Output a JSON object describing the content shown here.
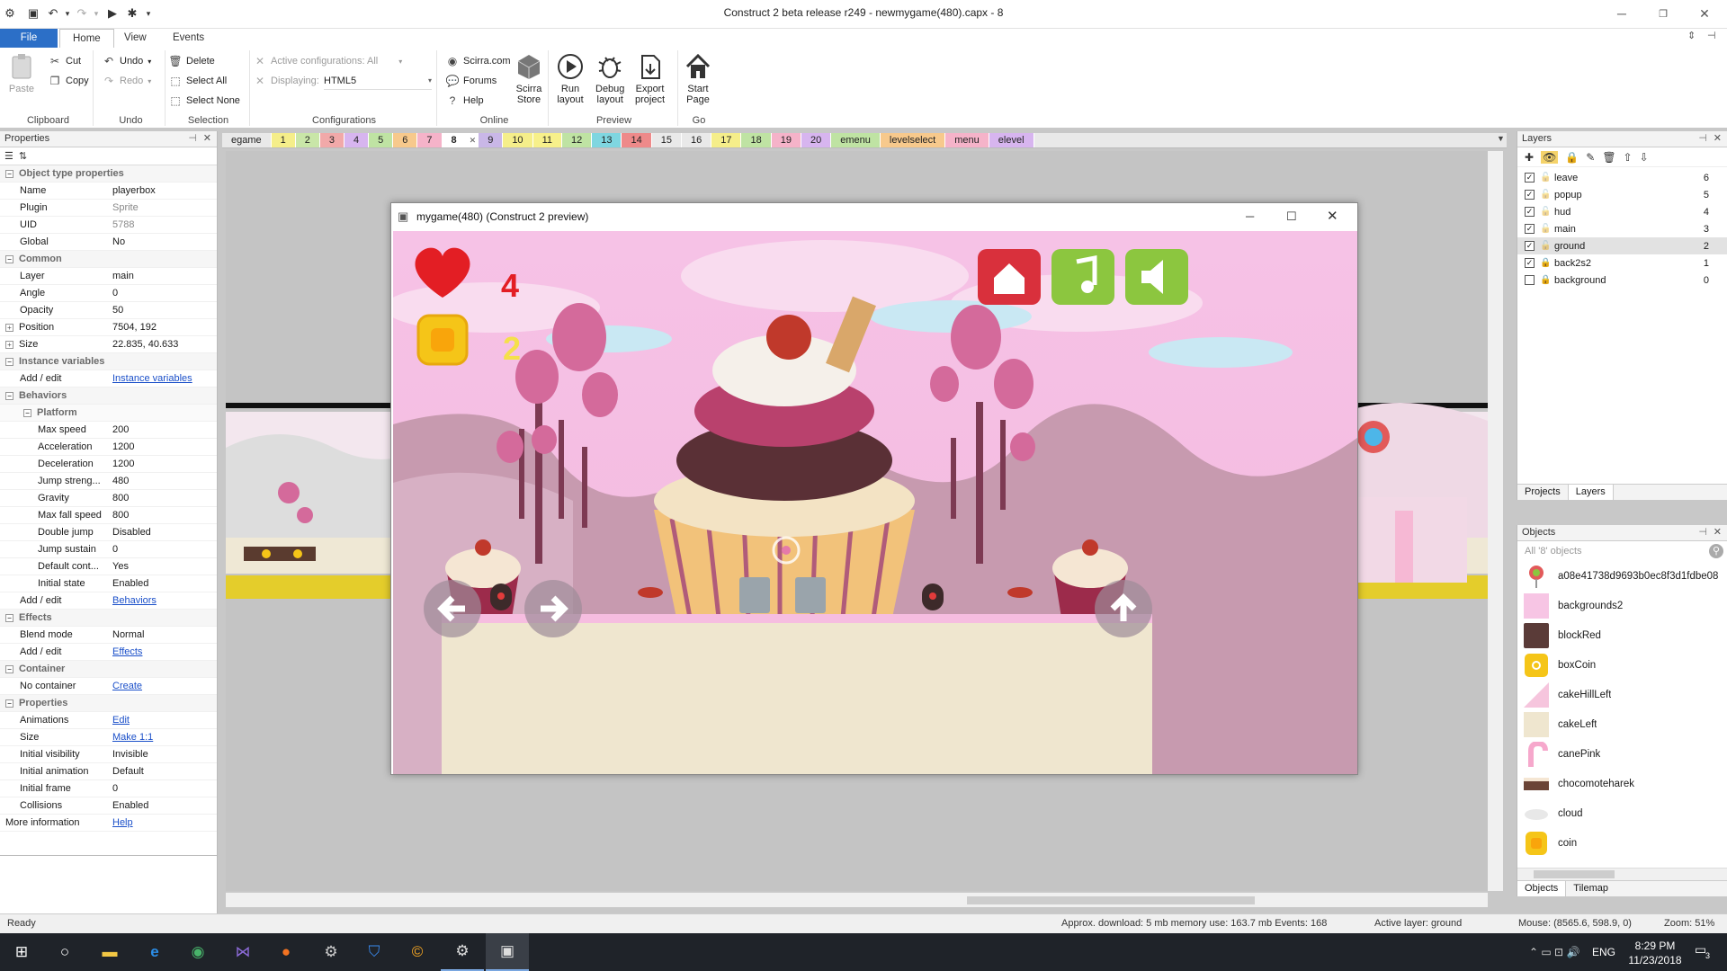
{
  "app": {
    "title": "Construct 2 beta release r249 - newmygame(480).capx - 8",
    "tabs": [
      "File",
      "Home",
      "View",
      "Events"
    ],
    "active_tab": "Home"
  },
  "ribbon": {
    "clipboard": {
      "paste": "Paste",
      "cut": "Cut",
      "copy": "Copy",
      "label": "Clipboard"
    },
    "undo": {
      "undo": "Undo",
      "redo": "Redo",
      "label": "Undo"
    },
    "selection": {
      "delete": "Delete",
      "select_all": "Select All",
      "select_none": "Select None",
      "label": "Selection"
    },
    "configurations": {
      "active": "Active configurations: All",
      "displaying_label": "Displaying:",
      "displaying_value": "HTML5",
      "label": "Configurations"
    },
    "online": {
      "scirra": "Scirra.com",
      "forums": "Forums",
      "help": "Help",
      "store_line1": "Scirra",
      "store_line2": "Store",
      "label": "Online"
    },
    "preview": {
      "run_1": "Run",
      "run_2": "layout",
      "debug_1": "Debug",
      "debug_2": "layout",
      "export_1": "Export",
      "export_2": "project",
      "label": "Preview"
    },
    "go": {
      "start_1": "Start",
      "start_2": "Page",
      "label": "Go"
    }
  },
  "properties": {
    "panel_title": "Properties",
    "rows": [
      {
        "type": "cat",
        "key": "Object type properties"
      },
      {
        "key": "Name",
        "value": "playerbox"
      },
      {
        "key": "Plugin",
        "value": "Sprite",
        "style": "grey"
      },
      {
        "key": "UID",
        "value": "5788",
        "style": "grey"
      },
      {
        "key": "Global",
        "value": "No"
      },
      {
        "type": "cat",
        "key": "Common"
      },
      {
        "key": "Layer",
        "value": "main"
      },
      {
        "key": "Angle",
        "value": "0"
      },
      {
        "key": "Opacity",
        "value": "50"
      },
      {
        "key": "Position",
        "value": "7504, 192",
        "expand": true
      },
      {
        "key": "Size",
        "value": "22.835, 40.633",
        "expand": true
      },
      {
        "type": "cat",
        "key": "Instance variables"
      },
      {
        "key": "Add / edit",
        "value": "Instance variables",
        "style": "link"
      },
      {
        "type": "cat",
        "key": "Behaviors"
      },
      {
        "type": "subcat",
        "key": "Platform"
      },
      {
        "key": "Max speed",
        "value": "200",
        "indent": true
      },
      {
        "key": "Acceleration",
        "value": "1200",
        "indent": true
      },
      {
        "key": "Deceleration",
        "value": "1200",
        "indent": true
      },
      {
        "key": "Jump streng...",
        "value": "480",
        "indent": true
      },
      {
        "key": "Gravity",
        "value": "800",
        "indent": true
      },
      {
        "key": "Max fall speed",
        "value": "800",
        "indent": true
      },
      {
        "key": "Double jump",
        "value": "Disabled",
        "indent": true
      },
      {
        "key": "Jump sustain",
        "value": "0",
        "indent": true
      },
      {
        "key": "Default cont...",
        "value": "Yes",
        "indent": true
      },
      {
        "key": "Initial state",
        "value": "Enabled",
        "indent": true
      },
      {
        "key": "Add / edit",
        "value": "Behaviors",
        "style": "link"
      },
      {
        "type": "cat",
        "key": "Effects"
      },
      {
        "key": "Blend mode",
        "value": "Normal"
      },
      {
        "key": "Add / edit",
        "value": "Effects",
        "style": "link"
      },
      {
        "type": "cat",
        "key": "Container"
      },
      {
        "key": "No container",
        "value": "Create",
        "style": "link"
      },
      {
        "type": "cat",
        "key": "Properties"
      },
      {
        "key": "Animations",
        "value": "Edit",
        "style": "link"
      },
      {
        "key": "Size",
        "value": "Make 1:1",
        "style": "link"
      },
      {
        "key": "Initial visibility",
        "value": "Invisible"
      },
      {
        "key": "Initial animation",
        "value": "Default"
      },
      {
        "key": "Initial frame",
        "value": "0"
      },
      {
        "key": "Collisions",
        "value": "Enabled"
      },
      {
        "key": "More information",
        "value": "Help",
        "style": "link",
        "flush": true
      }
    ]
  },
  "layout_tabs": [
    {
      "label": "egame",
      "color": "#e9e9e9"
    },
    {
      "label": "1",
      "color": "#f5ee8a"
    },
    {
      "label": "2",
      "color": "#c9e6a8"
    },
    {
      "label": "3",
      "color": "#f1a9a9"
    },
    {
      "label": "4",
      "color": "#d7b5ef"
    },
    {
      "label": "5",
      "color": "#bfe3a3"
    },
    {
      "label": "6",
      "color": "#f7c98c"
    },
    {
      "label": "7",
      "color": "#f5b3c9"
    },
    {
      "label": "8",
      "color": "#ffffff",
      "active": true
    },
    {
      "label": "9",
      "color": "#c9b7e7"
    },
    {
      "label": "10",
      "color": "#f5ee8a"
    },
    {
      "label": "11",
      "color": "#f7f08a"
    },
    {
      "label": "12",
      "color": "#bfe3a3"
    },
    {
      "label": "13",
      "color": "#7fd6e0"
    },
    {
      "label": "14",
      "color": "#ee8a8a"
    },
    {
      "label": "15",
      "color": "#e9e9e9"
    },
    {
      "label": "16",
      "color": "#e9e9e9"
    },
    {
      "label": "17",
      "color": "#f5ee8a"
    },
    {
      "label": "18",
      "color": "#bfe3a3"
    },
    {
      "label": "19",
      "color": "#f5b3c9"
    },
    {
      "label": "20",
      "color": "#d7b5ef"
    },
    {
      "label": "emenu",
      "color": "#bfe3a3"
    },
    {
      "label": "levelselect",
      "color": "#f7c98c"
    },
    {
      "label": "menu",
      "color": "#f5b3c9"
    },
    {
      "label": "elevel",
      "color": "#d7b5ef"
    }
  ],
  "preview_window": {
    "title": "mygame(480) (Construct 2 preview)",
    "lives": "4",
    "coins": "2"
  },
  "layers": {
    "panel_title": "Layers",
    "items": [
      {
        "name": "leave",
        "num": "6",
        "checked": true,
        "locked": false
      },
      {
        "name": "popup",
        "num": "5",
        "checked": true,
        "locked": false
      },
      {
        "name": "hud",
        "num": "4",
        "checked": true,
        "locked": false
      },
      {
        "name": "main",
        "num": "3",
        "checked": true,
        "locked": false
      },
      {
        "name": "ground",
        "num": "2",
        "checked": true,
        "locked": false,
        "selected": true
      },
      {
        "name": "back2s2",
        "num": "1",
        "checked": true,
        "locked": true
      },
      {
        "name": "background",
        "num": "0",
        "checked": false,
        "locked": true
      }
    ],
    "bottom_tabs": [
      "Projects",
      "Layers"
    ]
  },
  "objects": {
    "panel_title": "Objects",
    "filter": "All '8' objects",
    "items": [
      {
        "name": "a08e41738d9693b0ec8f3d1fdbe08",
        "thumb": "lollipop"
      },
      {
        "name": "backgrounds2",
        "thumb": "pink"
      },
      {
        "name": "blockRed",
        "thumb": "brown"
      },
      {
        "name": "boxCoin",
        "thumb": "coinbox"
      },
      {
        "name": "cakeHillLeft",
        "thumb": "hill"
      },
      {
        "name": "cakeLeft",
        "thumb": "cake"
      },
      {
        "name": "canePink",
        "thumb": "cane"
      },
      {
        "name": "chocomoteharek",
        "thumb": "choco"
      },
      {
        "name": "cloud",
        "thumb": "cloud"
      },
      {
        "name": "coin",
        "thumb": "coin"
      }
    ],
    "bottom_tabs": [
      "Objects",
      "Tilemap"
    ]
  },
  "status": {
    "ready": "Ready",
    "download": "Approx. download: 5 mb  memory use: 163.7 mb  Events: 168",
    "active_layer": "Active layer: ground",
    "mouse": "Mouse: (8565.6, 598.9, 0)",
    "zoom": "Zoom: 51%"
  },
  "taskbar": {
    "lang": "ENG",
    "time": "8:29 PM",
    "date": "11/23/2018",
    "notifications": "3"
  }
}
